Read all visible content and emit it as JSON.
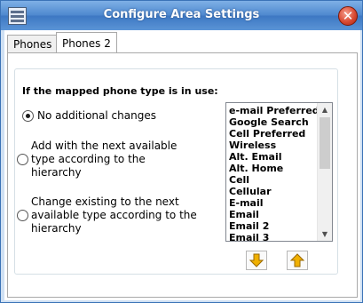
{
  "window": {
    "title": "Configure Area Settings",
    "icons": {
      "app": "settings-list-icon",
      "close": "close-icon"
    }
  },
  "tabs": [
    {
      "label": "Phones",
      "selected": false
    },
    {
      "label": "Phones 2",
      "selected": true
    }
  ],
  "group": {
    "legend": "If the mapped phone type is in use:",
    "options": [
      {
        "lines": [
          "No additional changes"
        ],
        "checked": true
      },
      {
        "lines": [
          "Add with the next available",
          "type according to the",
          "hierarchy"
        ],
        "checked": false
      },
      {
        "lines": [
          "Change existing to the next",
          "available type according to the",
          "hierarchy"
        ],
        "checked": false
      }
    ]
  },
  "hierarchy_list": {
    "items": [
      "e-mail Preferred",
      "Google Search",
      "Cell Preferred",
      "Wireless",
      "Alt. Email",
      "Alt. Home",
      "Cell",
      "Cellular",
      "E-mail",
      "Email",
      "Email 2",
      "Email 3"
    ]
  },
  "move_buttons": {
    "down_icon": "arrow-down-icon",
    "up_icon": "arrow-up-icon",
    "color": "#f0b000"
  },
  "colors": {
    "titlebar": "#4f89cf",
    "close": "#d94a32"
  }
}
